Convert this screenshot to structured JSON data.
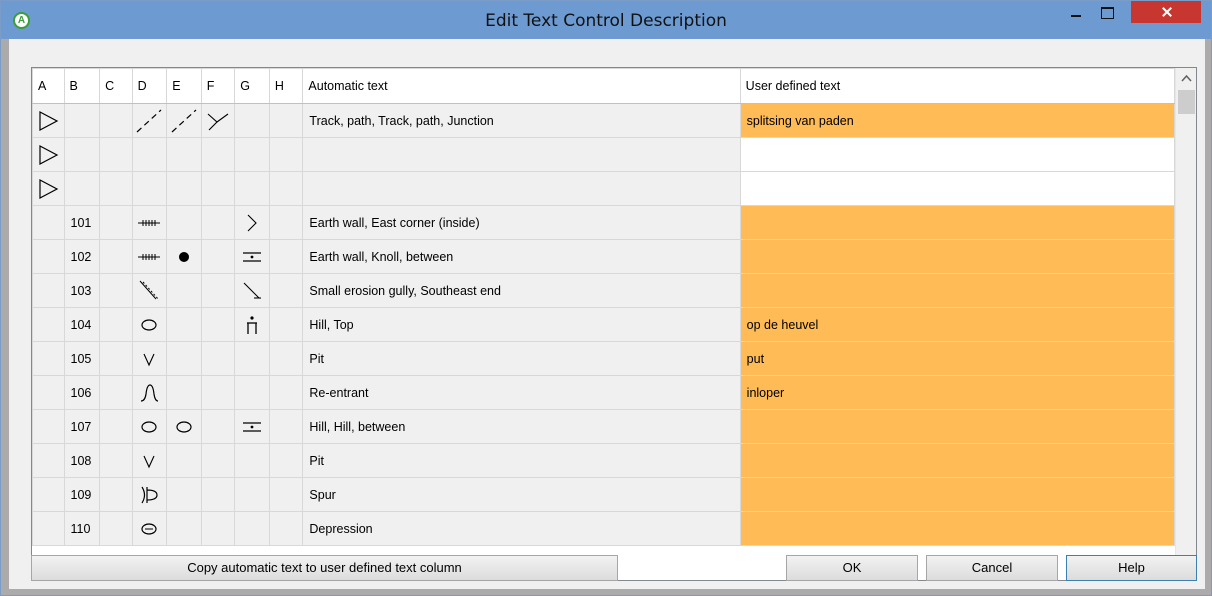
{
  "window": {
    "title": "Edit Text Control Description",
    "app_icon_letter": "A"
  },
  "grid": {
    "headers": {
      "a": "A",
      "b": "B",
      "c": "C",
      "d": "D",
      "e": "E",
      "f": "F",
      "g": "G",
      "h": "H",
      "auto": "Automatic text",
      "user": "User defined text"
    },
    "rows": [
      {
        "a": "triangle",
        "b": "",
        "d": "track",
        "e": "track",
        "f": "junction",
        "g": "",
        "auto": "Track, path, Track, path, Junction",
        "user": "splitsing van paden",
        "user_highlight": true
      },
      {
        "a": "triangle",
        "b": "",
        "d": "",
        "e": "",
        "f": "",
        "g": "",
        "auto": "",
        "user": "",
        "user_highlight": false
      },
      {
        "a": "triangle",
        "b": "",
        "d": "",
        "e": "",
        "f": "",
        "g": "",
        "auto": "",
        "user": "",
        "user_highlight": false
      },
      {
        "a": "",
        "b": "101",
        "d": "earth-wall",
        "e": "",
        "f": "",
        "g": "east-corner-inside",
        "auto": "Earth wall, East corner (inside)",
        "user": "",
        "user_highlight": true
      },
      {
        "a": "",
        "b": "102",
        "d": "earth-wall",
        "e": "knoll",
        "f": "",
        "g": "between",
        "auto": "Earth wall, Knoll, between",
        "user": "",
        "user_highlight": true
      },
      {
        "a": "",
        "b": "103",
        "d": "erosion-gully",
        "e": "",
        "f": "",
        "g": "southeast-end",
        "auto": "Small erosion gully, Southeast end",
        "user": "",
        "user_highlight": true
      },
      {
        "a": "",
        "b": "104",
        "d": "hill",
        "e": "",
        "f": "",
        "g": "top",
        "auto": "Hill, Top",
        "user": "op de heuvel",
        "user_highlight": true
      },
      {
        "a": "",
        "b": "105",
        "d": "pit",
        "e": "",
        "f": "",
        "g": "",
        "auto": "Pit",
        "user": "put",
        "user_highlight": true
      },
      {
        "a": "",
        "b": "106",
        "d": "re-entrant",
        "e": "",
        "f": "",
        "g": "",
        "auto": "Re-entrant",
        "user": "inloper",
        "user_highlight": true
      },
      {
        "a": "",
        "b": "107",
        "d": "hill",
        "e": "hill",
        "f": "",
        "g": "between",
        "auto": "Hill, Hill, between",
        "user": "",
        "user_highlight": true
      },
      {
        "a": "",
        "b": "108",
        "d": "pit",
        "e": "",
        "f": "",
        "g": "",
        "auto": "Pit",
        "user": "",
        "user_highlight": true
      },
      {
        "a": "",
        "b": "109",
        "d": "spur",
        "e": "",
        "f": "",
        "g": "",
        "auto": "Spur",
        "user": "",
        "user_highlight": true
      },
      {
        "a": "",
        "b": "110",
        "d": "depression",
        "e": "",
        "f": "",
        "g": "",
        "auto": "Depression",
        "user": "",
        "user_highlight": true
      }
    ]
  },
  "buttons": {
    "copy": "Copy automatic text to user defined text column",
    "ok": "OK",
    "cancel": "Cancel",
    "help": "Help"
  }
}
